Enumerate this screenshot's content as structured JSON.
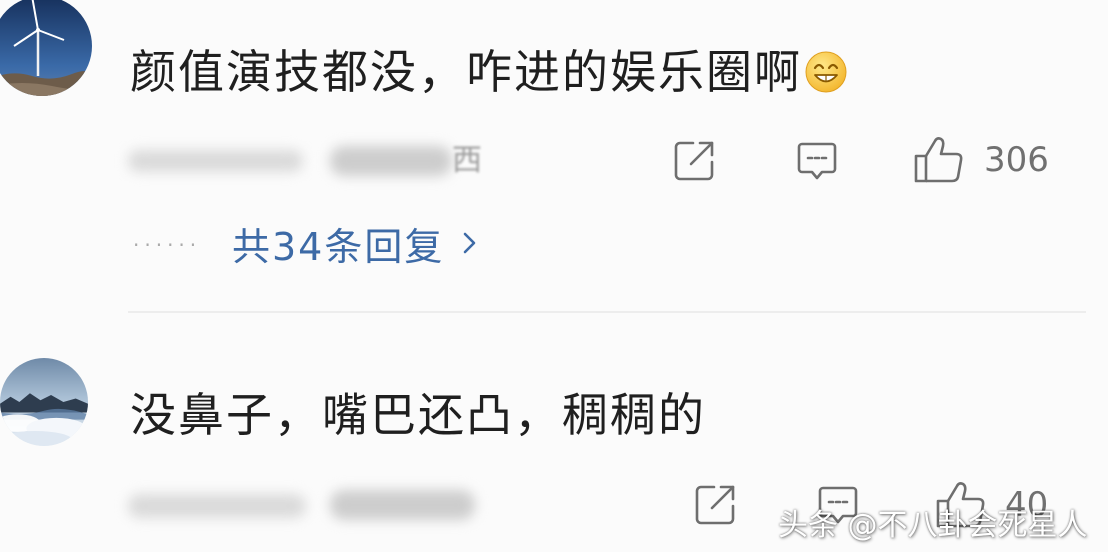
{
  "colors": {
    "background": "#fbfbfb",
    "text": "#1f1f1f",
    "icon": "#6e6e6e",
    "link": "#3d6aa6",
    "divider": "#ededed"
  },
  "icons": {
    "emoji": "grin-emoji-icon",
    "share": "share-icon",
    "comment": "comment-icon",
    "like": "thumb-up-icon",
    "chevron": "chevron-right-icon"
  },
  "comments": [
    {
      "text": "颜值演技都没，咋进的娱乐圈啊",
      "meta_tail": "西",
      "like_count": "306",
      "replies": {
        "dots": "······",
        "label": "共34条回复"
      }
    },
    {
      "text": "没鼻子，嘴巴还凸，稠稠的",
      "like_count": "40"
    }
  ],
  "watermark": "头条 @不八卦会死星人"
}
